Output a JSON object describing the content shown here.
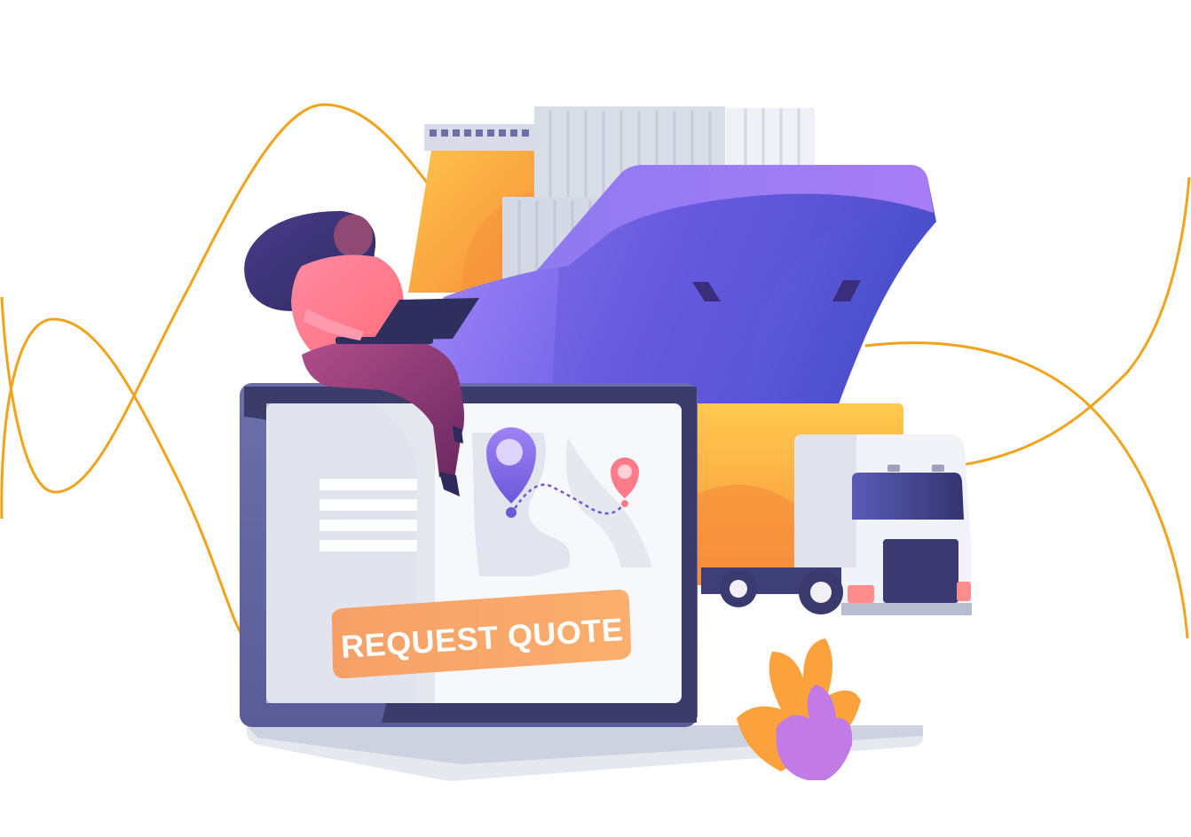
{
  "illustration": {
    "cta_label": "REQUEST QUOTE"
  },
  "colors": {
    "accent_orange": "#F2A31C",
    "ship_purple": "#7A63E6",
    "ship_deep": "#4E4FCF",
    "laptop_frame": "#3A3A66",
    "person_pink": "#FF7E95",
    "cta_orange": "#F8A46A"
  },
  "icons": {
    "map_pin_large": "map-pin-icon",
    "map_pin_small": "map-pin-icon",
    "truck": "truck-icon",
    "ship": "ship-icon"
  }
}
